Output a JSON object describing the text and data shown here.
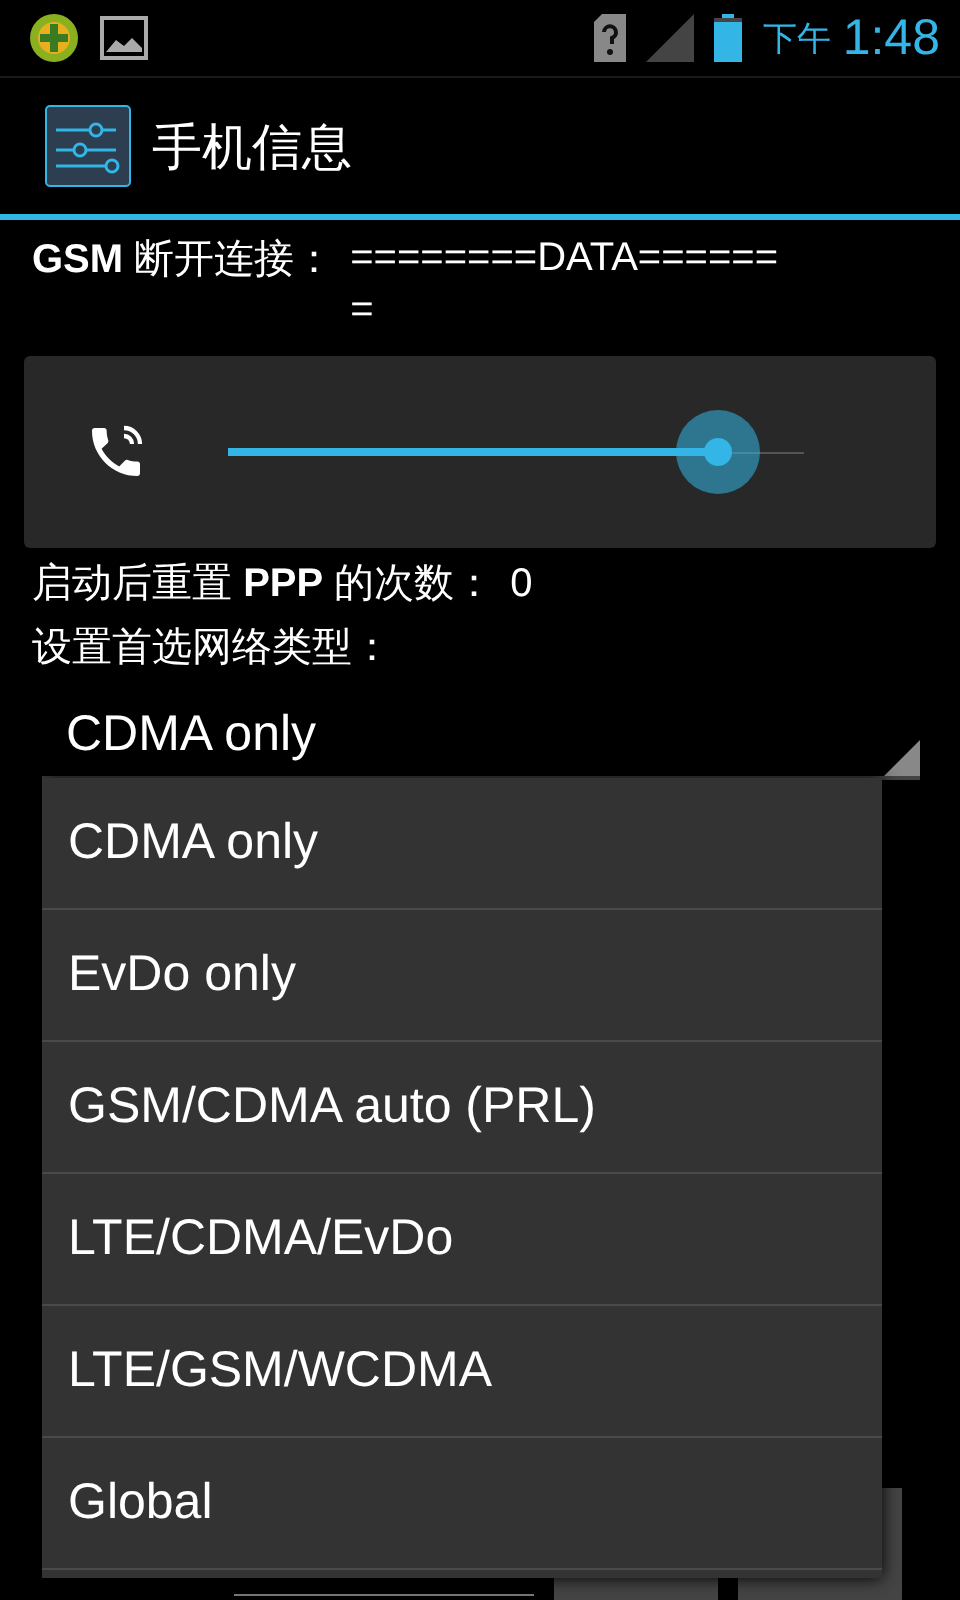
{
  "status_bar": {
    "time_period": "下午",
    "time": "1:48"
  },
  "action_bar": {
    "title": "手机信息"
  },
  "gsm_disconnect": {
    "label": "**GSM** 断开连接：",
    "value": "========DATA======\n="
  },
  "volume": {
    "level": 0.85
  },
  "ppp_resets": {
    "label": "启动后重置 **PPP** 的次数：",
    "value": "0"
  },
  "network_type": {
    "label": "设置首选网络类型：",
    "value": "CDMA only"
  },
  "popup": {
    "options": [
      "CDMA only",
      "EvDo only",
      "GSM/CDMA auto (PRL)",
      "LTE/CDMA/EvDo",
      "LTE/GSM/WCDMA",
      "Global"
    ]
  }
}
